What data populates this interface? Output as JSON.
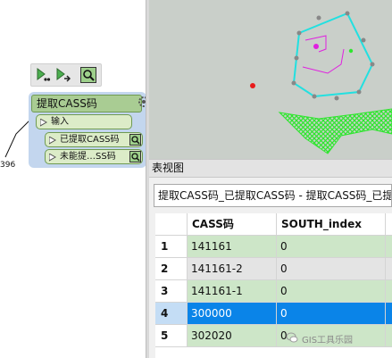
{
  "workbench": {
    "transformer_title": "提取CASS码",
    "input_port": "输入",
    "output_ports": [
      "已提取CASS码",
      "未能提…SS码"
    ],
    "feature_count": "396"
  },
  "table_panel": {
    "title": "表视图",
    "active_tab": "提取CASS码_已提取CASS码 - 提取CASS码_已提取C",
    "columns": [
      "CASS码",
      "SOUTH_index"
    ],
    "rows": [
      {
        "num": "1",
        "cass": "141161",
        "south": "0",
        "selected": false
      },
      {
        "num": "2",
        "cass": "141161-2",
        "south": "0",
        "selected": false
      },
      {
        "num": "3",
        "cass": "141161-1",
        "south": "0",
        "selected": false
      },
      {
        "num": "4",
        "cass": "300000",
        "south": "0",
        "selected": true
      },
      {
        "num": "5",
        "cass": "302020",
        "south": "0",
        "selected": false
      }
    ]
  },
  "colors": {
    "row_green": "#cde6c8",
    "row_gray": "#e4e4e4",
    "row_selected": "#0a84e8",
    "rownum_selected": "#c4ddf5",
    "polygon_cyan": "#22e0e0",
    "hatch_green": "#2ee62e"
  },
  "watermark": "GIS工具乐园"
}
